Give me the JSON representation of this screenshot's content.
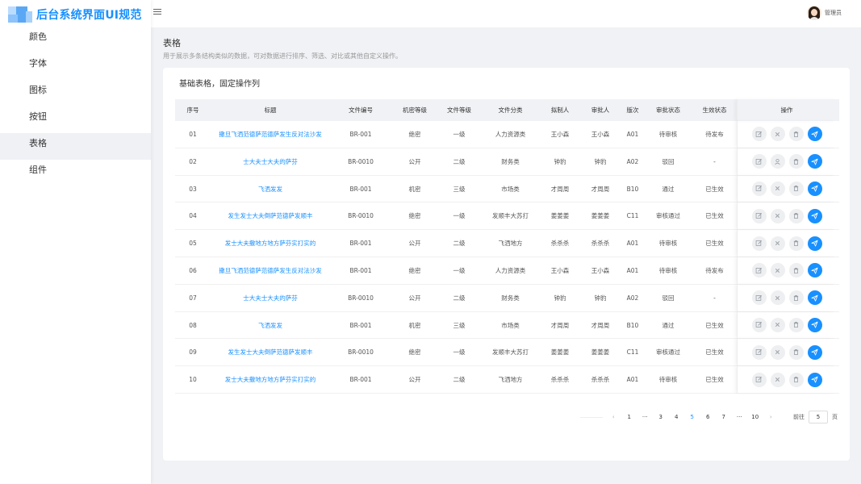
{
  "app": {
    "title": "后台系统界面UI规范"
  },
  "sidebar": {
    "items": [
      {
        "label": "颜色"
      },
      {
        "label": "字体"
      },
      {
        "label": "图标"
      },
      {
        "label": "按钮"
      },
      {
        "label": "表格",
        "active": true
      },
      {
        "label": "组件"
      }
    ]
  },
  "header": {
    "user_name": "管理员"
  },
  "page": {
    "title": "表格",
    "description": "用于展示多条结构类似的数据，可对数据进行排序、筛选、对比或其他自定义操作。"
  },
  "card": {
    "title": "基础表格，固定操作列"
  },
  "table": {
    "columns": [
      "序号",
      "标题",
      "文件编号",
      "机密等级",
      "文件等级",
      "文件分类",
      "拟制人",
      "审批人",
      "版次",
      "审批状态",
      "生效状态",
      "操作"
    ],
    "rows": [
      [
        "01",
        "撒旦飞洒范德萨范德萨发生反对法沙发",
        "BR-001",
        "绝密",
        "一级",
        "人力资源类",
        "王小森",
        "王小森",
        "A01",
        "待审核",
        "待发布"
      ],
      [
        "02",
        "士大夫士大夫的萨芬",
        "BR-0010",
        "公开",
        "二级",
        "财务类",
        "钟豹",
        "钟豹",
        "A02",
        "驳回",
        "-"
      ],
      [
        "03",
        "飞洒发发",
        "BR-001",
        "机密",
        "三级",
        "市场类",
        "才周周",
        "才周周",
        "B10",
        "通过",
        "已生效"
      ],
      [
        "04",
        "发生发士大夫倒萨范德萨发顺丰",
        "BR-0010",
        "绝密",
        "一级",
        "发顺丰大苏打",
        "姜姜姜",
        "姜姜姜",
        "C11",
        "审核通过",
        "已生效"
      ],
      [
        "05",
        "发士大夫撒地方地方萨芬实打实的",
        "BR-001",
        "公开",
        "二级",
        "飞洒地方",
        "杀杀杀",
        "杀杀杀",
        "A01",
        "待审核",
        "已生效"
      ],
      [
        "06",
        "撒旦飞洒范德萨范德萨发生反对法沙发",
        "BR-001",
        "绝密",
        "一级",
        "人力资源类",
        "王小森",
        "王小森",
        "A01",
        "待审核",
        "待发布"
      ],
      [
        "07",
        "士大夫士大夫的萨芬",
        "BR-0010",
        "公开",
        "二级",
        "财务类",
        "钟豹",
        "钟豹",
        "A02",
        "驳回",
        "-"
      ],
      [
        "08",
        "飞洒发发",
        "BR-001",
        "机密",
        "三级",
        "市场类",
        "才周周",
        "才周周",
        "B10",
        "通过",
        "已生效"
      ],
      [
        "09",
        "发生发士大夫倒萨范德萨发顺丰",
        "BR-0010",
        "绝密",
        "一级",
        "发顺丰大苏打",
        "姜姜姜",
        "姜姜姜",
        "C11",
        "审核通过",
        "已生效"
      ],
      [
        "10",
        "发士大夫撒地方地方萨芬实打实的",
        "BR-001",
        "公开",
        "二级",
        "飞洒地方",
        "杀杀杀",
        "杀杀杀",
        "A01",
        "待审核",
        "已生效"
      ]
    ],
    "row_second_icon": [
      "close-icon",
      "user-icon",
      "close-icon",
      "close-icon",
      "close-icon",
      "close-icon",
      "close-icon",
      "close-icon",
      "close-icon",
      "close-icon"
    ]
  },
  "pagination": {
    "prev": "‹",
    "next": "›",
    "pages": [
      "1",
      "···",
      "3",
      "4",
      "5",
      "6",
      "7",
      "···",
      "10"
    ],
    "current": "5",
    "goto_label": "前往",
    "goto_value": "5",
    "goto_unit": "页"
  },
  "colors": {
    "primary": "#1890ff",
    "sidebar_active": "#eff1f5",
    "page_bg": "#f0f2f5"
  }
}
